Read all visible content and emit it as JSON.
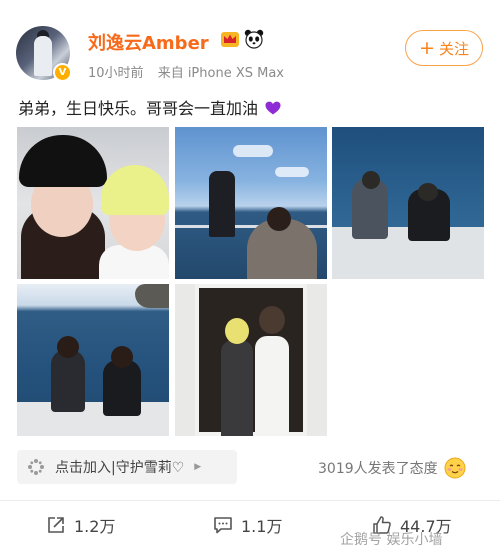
{
  "post": {
    "username": "刘逸云Amber",
    "time": "10小时前",
    "source": "来自 iPhone XS Max",
    "follow_label": "关注",
    "text": "弟弟，生日快乐。哥哥会一直加油"
  },
  "group": {
    "label": "点击加入|守护雪莉♡"
  },
  "reactions": {
    "text": "3019人发表了态度"
  },
  "actions": {
    "repost": "1.2万",
    "comment": "1.1万",
    "like": "44.7万"
  },
  "watermark": {
    "text": "企鹅号 娱乐小墙"
  },
  "colors": {
    "username": "#f86a1b",
    "follow_border": "#f9a24c",
    "verified_badge": "#ffae00",
    "heart": "#8e2bd6"
  },
  "icons": [
    "crown-icon",
    "panda-icon",
    "verified-icon",
    "purple-heart-icon",
    "plus-icon",
    "group-icon",
    "chevron-right-icon",
    "emoji-icon",
    "repost-icon",
    "comment-icon",
    "like-icon"
  ]
}
